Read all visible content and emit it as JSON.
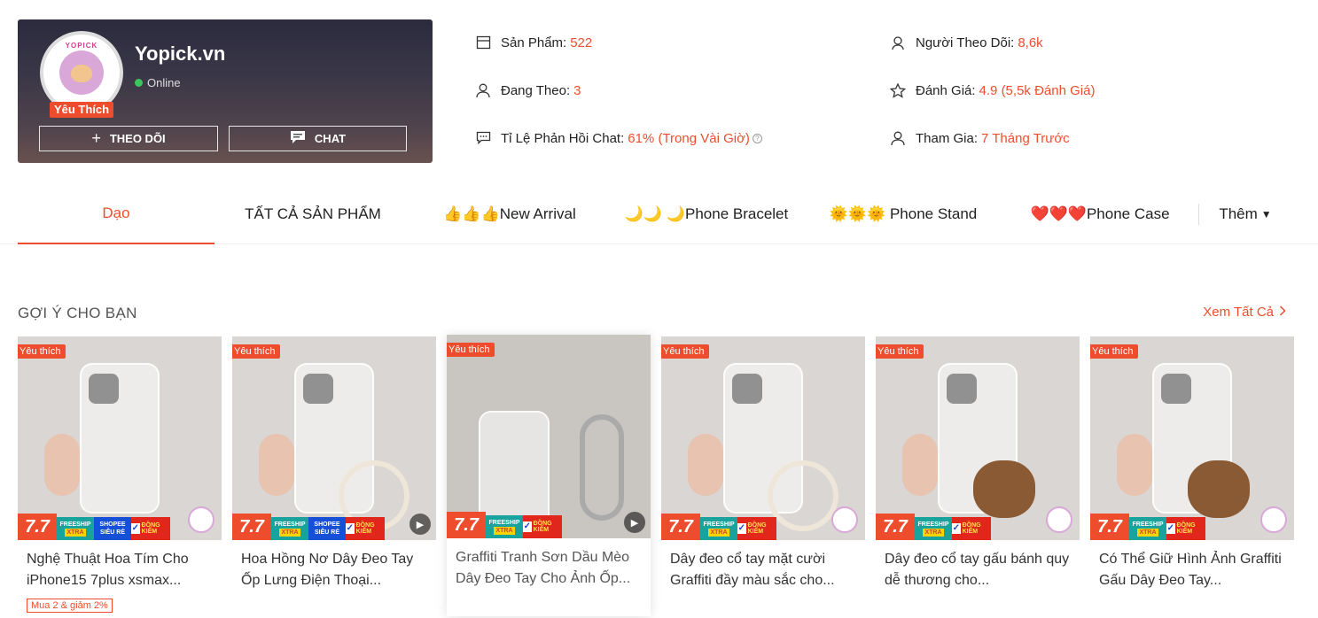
{
  "shop": {
    "logo_text": "YOPICK",
    "preferred_badge": "Yêu Thích",
    "name": "Yopick.vn",
    "status": "Online",
    "follow_label": "THEO DÕI",
    "chat_label": "CHAT"
  },
  "stats": {
    "products_label": "Sản Phẩm:",
    "products_value": "522",
    "following_label": "Đang Theo:",
    "following_value": "3",
    "chat_rate_label": "Tỉ Lệ Phản Hồi Chat:",
    "chat_rate_value": "61% (Trong Vài Giờ)",
    "followers_label": "Người Theo Dõi:",
    "followers_value": "8,6k",
    "rating_label": "Đánh Giá:",
    "rating_value": "4.9 (5,5k Đánh Giá)",
    "joined_label": "Tham Gia:",
    "joined_value": "7 Tháng Trước"
  },
  "tabs": [
    {
      "label": "Dạo"
    },
    {
      "label": "TẤT CẢ SẢN PHẨM"
    },
    {
      "label": "👍👍👍New Arrival"
    },
    {
      "label": "🌙🌙 🌙Phone Bracelet"
    },
    {
      "label": "🌞🌞🌞 Phone Stand"
    },
    {
      "label": "❤️❤️❤️Phone Case"
    },
    {
      "label": "Thêm"
    }
  ],
  "recommend": {
    "title": "GỢI Ý CHO BẠN",
    "see_all": "Xem Tất Cả"
  },
  "promo": {
    "sale": "7.7",
    "freeship": "FREESHIP",
    "xtra": "XTRA",
    "shopee": "SHOPEE",
    "sieu_re": "SIÊU RẺ",
    "dong_kiem": "ĐỒNG KIỂM"
  },
  "products": [
    {
      "badge": "Yêu thích",
      "name": "Nghệ Thuật Hoa Tím Cho iPhone15 7plus xsmax...",
      "promo_label": "Mua 2 & giảm 2%"
    },
    {
      "badge": "Yêu thích",
      "name": "Hoa Hồng Nơ Dây Đeo Tay Ốp Lưng Điện Thoại..."
    },
    {
      "badge": "Yêu thích",
      "name": "Graffiti Tranh Sơn Dầu Mèo Dây Đeo Tay Cho Ảnh Ốp..."
    },
    {
      "badge": "Yêu thích",
      "name": "Dây đeo cổ tay mặt cười Graffiti đầy màu sắc cho..."
    },
    {
      "badge": "Yêu thích",
      "name": "Dây đeo cổ tay gấu bánh quy dễ thương cho..."
    },
    {
      "badge": "Yêu thích",
      "name": "Có Thể Giữ Hình Ảnh Graffiti Gấu Dây Đeo Tay..."
    }
  ]
}
